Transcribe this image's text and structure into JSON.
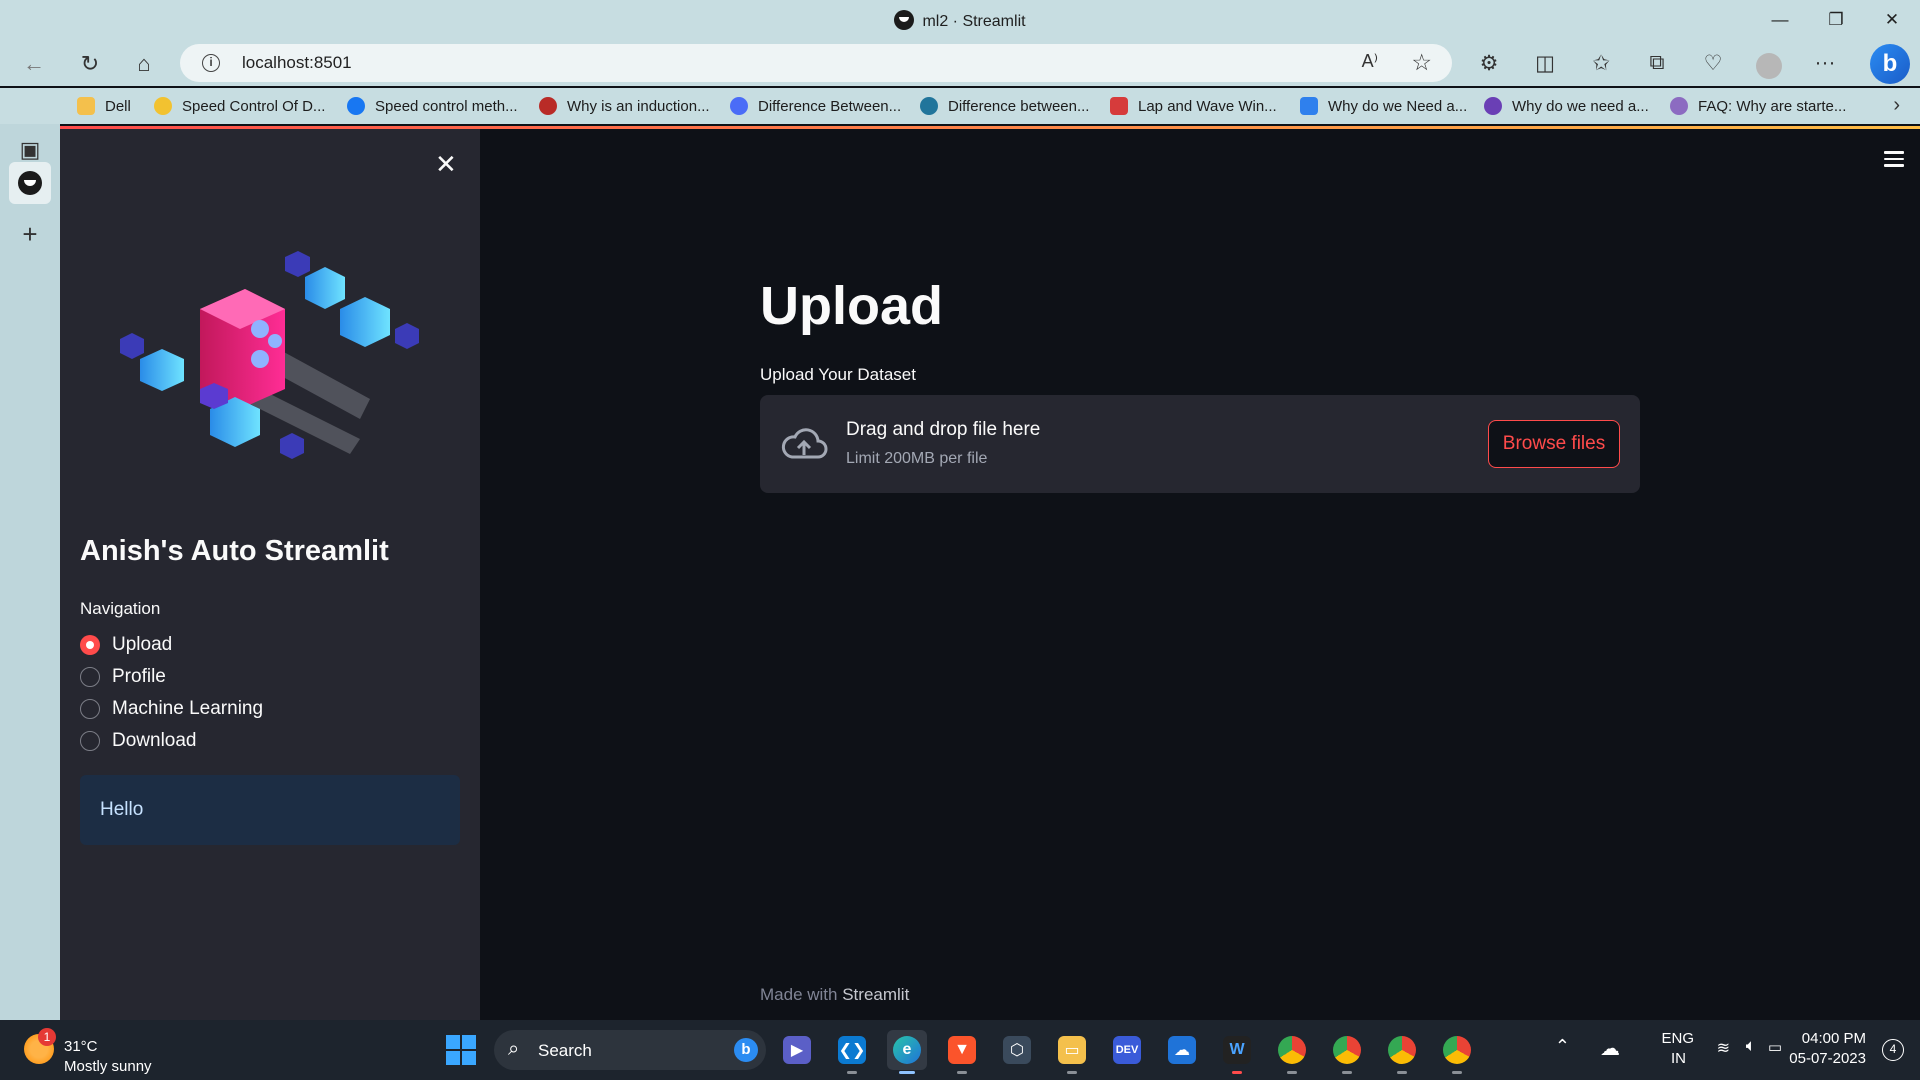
{
  "browser": {
    "window_title": "ml2 · Streamlit",
    "url": "localhost:8501",
    "window_controls": {
      "minimize": "—",
      "restore": "❐",
      "close": "✕"
    },
    "favorites": [
      {
        "label": "Dell",
        "icon": "folder-icon",
        "color": "#f4c04c"
      },
      {
        "label": "Speed Control Of D...",
        "icon": "bulb-icon",
        "color": "#f2c230"
      },
      {
        "label": "Speed control meth...",
        "icon": "info-circle-icon",
        "color": "#1877f2"
      },
      {
        "label": "Why is an induction...",
        "icon": "quora-icon",
        "color": "#b92b27"
      },
      {
        "label": "Difference Between...",
        "icon": "site-icon",
        "color": "#4a6cf7"
      },
      {
        "label": "Difference between...",
        "icon": "wordpress-icon",
        "color": "#21759b"
      },
      {
        "label": "Lap and Wave Win...",
        "icon": "site-icon",
        "color": "#d63b3b"
      },
      {
        "label": "Why do we Need a...",
        "icon": "check-icon",
        "color": "#2f80ed"
      },
      {
        "label": "Why do we need a...",
        "icon": "e-icon",
        "color": "#6a3fb5"
      },
      {
        "label": "FAQ: Why are starte...",
        "icon": "site-icon",
        "color": "#8c6bc1"
      }
    ]
  },
  "sidebar": {
    "title": "Anish's Auto Streamlit",
    "nav_label": "Navigation",
    "nav_options": [
      "Upload",
      "Profile",
      "Machine Learning",
      "Download"
    ],
    "selected": "Upload",
    "info_text": "Hello"
  },
  "main": {
    "page_title": "Upload",
    "uploader_label": "Upload Your Dataset",
    "dropzone_text": "Drag and drop file here",
    "dropzone_limit": "Limit 200MB per file",
    "browse_label": "Browse files",
    "footer_prefix": "Made with",
    "footer_brand": "Streamlit"
  },
  "taskbar": {
    "weather_badge": "1",
    "weather_temp": "31°C",
    "weather_desc": "Mostly sunny",
    "search_placeholder": "Search",
    "lang_line1": "ENG",
    "lang_line2": "IN",
    "time": "04:00 PM",
    "date": "05-07-2023",
    "notification_count": "4"
  },
  "colors": {
    "accent": "#ff4b4b",
    "sidebar_bg": "#262730",
    "main_bg": "#0e1117",
    "info_bg": "#1c2d44"
  }
}
